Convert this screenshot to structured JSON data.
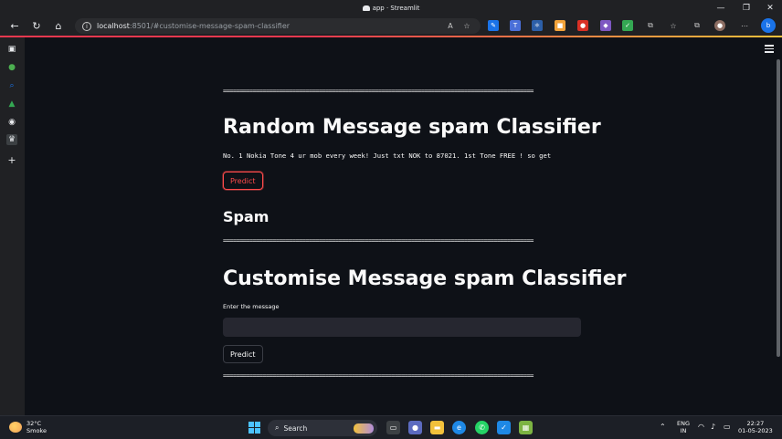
{
  "browser": {
    "window_title": "app · Streamlit",
    "url_host": "localhost",
    "url_rest": ":8501/#customise-message-spam-classifier",
    "window_controls": [
      "—",
      "❐",
      "✕"
    ]
  },
  "streamlit": {
    "separator": "==============================================================================================",
    "random_title": "Random Message spam Classifier",
    "random_message": "No. 1 Nokia Tone 4 ur mob every week! Just txt NOK to 87021. 1st Tone FREE ! so get",
    "predict_label": "Predict",
    "result": "Spam",
    "custom_title": "Customise Message spam Classifier",
    "input_label": "Enter the message",
    "input_value": "",
    "predict_label_2": "Predict"
  },
  "taskbar": {
    "temperature": "32°C",
    "weather": "Smoke",
    "search_label": "Search",
    "lang_top": "ENG",
    "lang_bottom": "IN",
    "time": "22:27",
    "date": "01-05-2023"
  },
  "colors": {
    "page_bg": "#0e1117",
    "accent_red": "#ff4b4b",
    "input_bg": "#262730"
  }
}
